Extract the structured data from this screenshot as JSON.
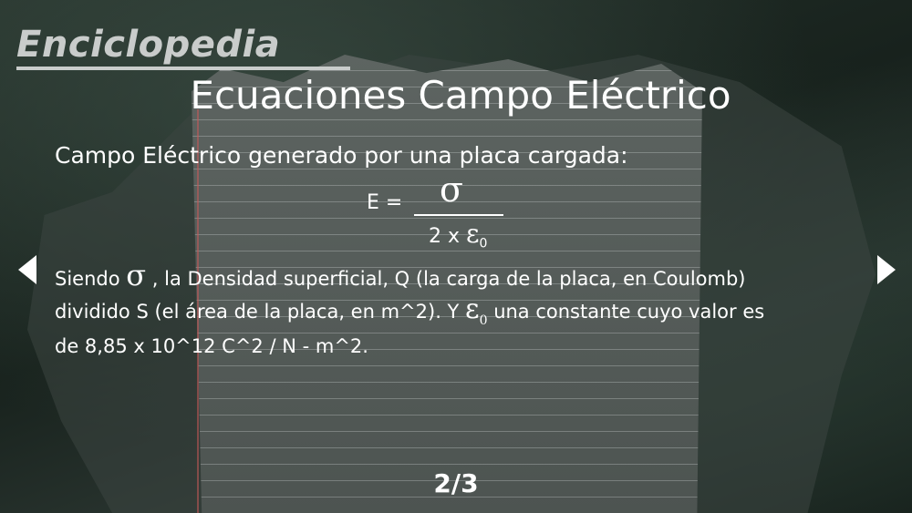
{
  "header": {
    "logo": "Enciclopedia",
    "title": "Ecuaciones Campo Eléctrico"
  },
  "content": {
    "subtitle": "Campo Eléctrico generado por una placa cargada:",
    "formula": {
      "lhs": "E =",
      "numerator": "σ",
      "denominator_prefix": "2 x ",
      "epsilon": "ε",
      "epsilon_sub": "0"
    },
    "paragraph": {
      "part1": "Siendo ",
      "sigma": "σ",
      "part2": " , la Densidad superficial, Q (la carga de la placa, en Coulomb) dividido S (el área de la placa, en m^2). Y ",
      "epsilon": "ε",
      "epsilon_sub": "0",
      "part3": " una constante cuyo valor es de 8,85 x 10^12 C^2 / N - m^2."
    }
  },
  "navigation": {
    "left_icon": "triangle-left-icon",
    "right_icon": "triangle-right-icon",
    "page": "2/3"
  },
  "colors": {
    "text": "#ffffff",
    "logo": "#c9cccb",
    "background": "#1f2a24"
  }
}
